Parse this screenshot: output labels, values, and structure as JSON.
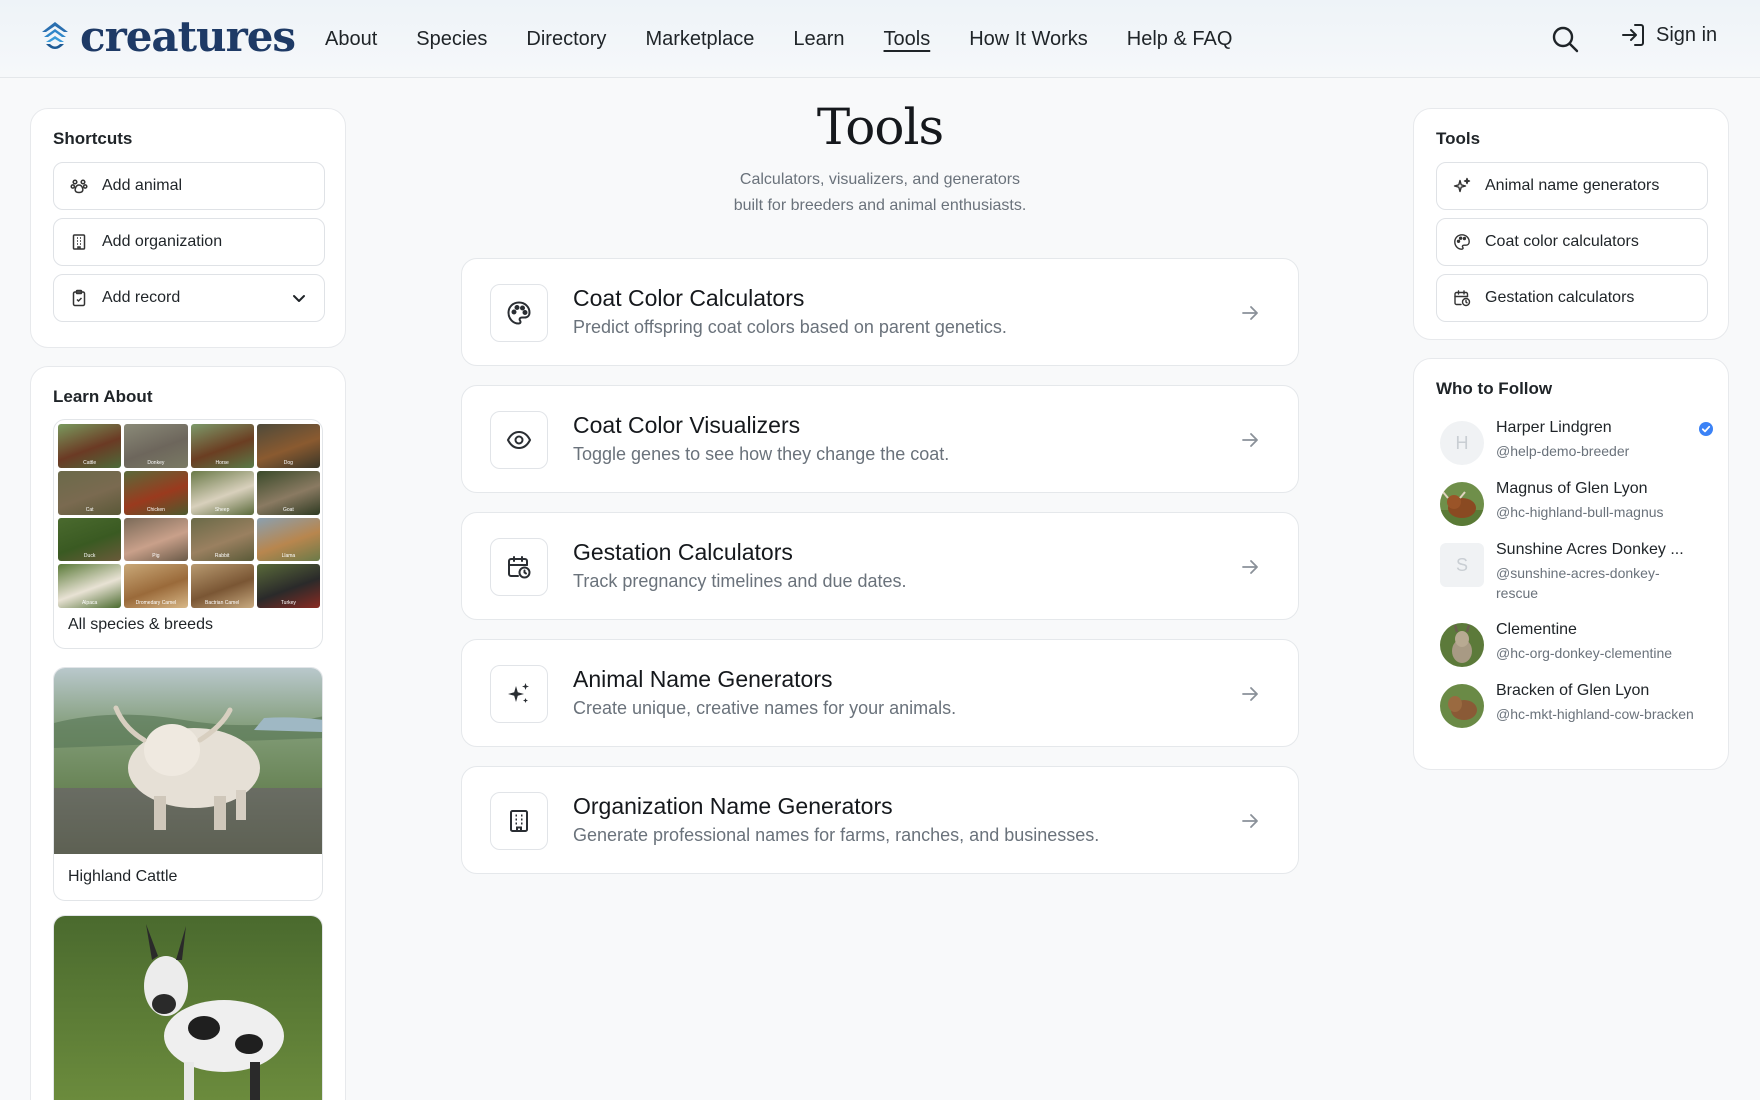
{
  "header": {
    "logo_text": "creatures",
    "nav": [
      {
        "label": "About",
        "active": false
      },
      {
        "label": "Species",
        "active": false
      },
      {
        "label": "Directory",
        "active": false
      },
      {
        "label": "Marketplace",
        "active": false
      },
      {
        "label": "Learn",
        "active": false
      },
      {
        "label": "Tools",
        "active": true
      },
      {
        "label": "How It Works",
        "active": false
      },
      {
        "label": "Help & FAQ",
        "active": false
      }
    ],
    "search_icon": "search-icon",
    "signin_label": "Sign in"
  },
  "shortcuts": {
    "title": "Shortcuts",
    "items": [
      {
        "label": "Add animal",
        "icon": "paw-icon"
      },
      {
        "label": "Add organization",
        "icon": "building-icon"
      },
      {
        "label": "Add record",
        "icon": "clipboard-icon",
        "has_dropdown": true
      }
    ]
  },
  "learn": {
    "title": "Learn About",
    "grid_labels": [
      "Cattle",
      "Donkey",
      "Horse",
      "Dog",
      "Cat",
      "Chicken",
      "Sheep",
      "Goat",
      "Duck",
      "Pig",
      "Rabbit",
      "Llama",
      "Alpaca",
      "Dromedary Camel",
      "Bactrian Camel",
      "Turkey"
    ],
    "grid_caption": "All species & breeds",
    "cards": [
      {
        "caption": "Highland Cattle"
      },
      {
        "caption": ""
      }
    ]
  },
  "main": {
    "title": "Tools",
    "subtitle_line1": "Calculators, visualizers, and generators",
    "subtitle_line2": "built for breeders and animal enthusiasts.",
    "tools": [
      {
        "title": "Coat Color Calculators",
        "desc": "Predict offspring coat colors based on parent genetics.",
        "icon": "palette-icon"
      },
      {
        "title": "Coat Color Visualizers",
        "desc": "Toggle genes to see how they change the coat.",
        "icon": "eye-icon"
      },
      {
        "title": "Gestation Calculators",
        "desc": "Track pregnancy timelines and due dates.",
        "icon": "calendar-clock-icon"
      },
      {
        "title": "Animal Name Generators",
        "desc": "Create unique, creative names for your animals.",
        "icon": "sparkles-icon"
      },
      {
        "title": "Organization Name Generators",
        "desc": "Generate professional names for farms, ranches, and businesses.",
        "icon": "building-icon"
      }
    ]
  },
  "sidebar_tools": {
    "title": "Tools",
    "items": [
      {
        "label": "Animal name generators",
        "icon": "sparkles-icon"
      },
      {
        "label": "Coat color calculators",
        "icon": "palette-icon"
      },
      {
        "label": "Gestation calculators",
        "icon": "calendar-clock-icon"
      }
    ]
  },
  "follow": {
    "title": "Who to Follow",
    "people": [
      {
        "name": "Harper Lindgren",
        "handle": "@help-demo-breeder",
        "initial": "H",
        "verified": true
      },
      {
        "name": "Magnus of Glen Lyon",
        "handle": "@hc-highland-bull-magnus",
        "initial": "",
        "verified": false
      },
      {
        "name": "Sunshine Acres Donkey ...",
        "handle": "@sunshine-acres-donkey-rescue",
        "initial": "S",
        "verified": false
      },
      {
        "name": "Clementine",
        "handle": "@hc-org-donkey-clementine",
        "initial": "",
        "verified": false
      },
      {
        "name": "Bracken of Glen Lyon",
        "handle": "@hc-mkt-highland-cow-bracken",
        "initial": "",
        "verified": false
      }
    ]
  },
  "colors": {
    "brand": "#1e3a66",
    "verified": "#3b82f6"
  }
}
